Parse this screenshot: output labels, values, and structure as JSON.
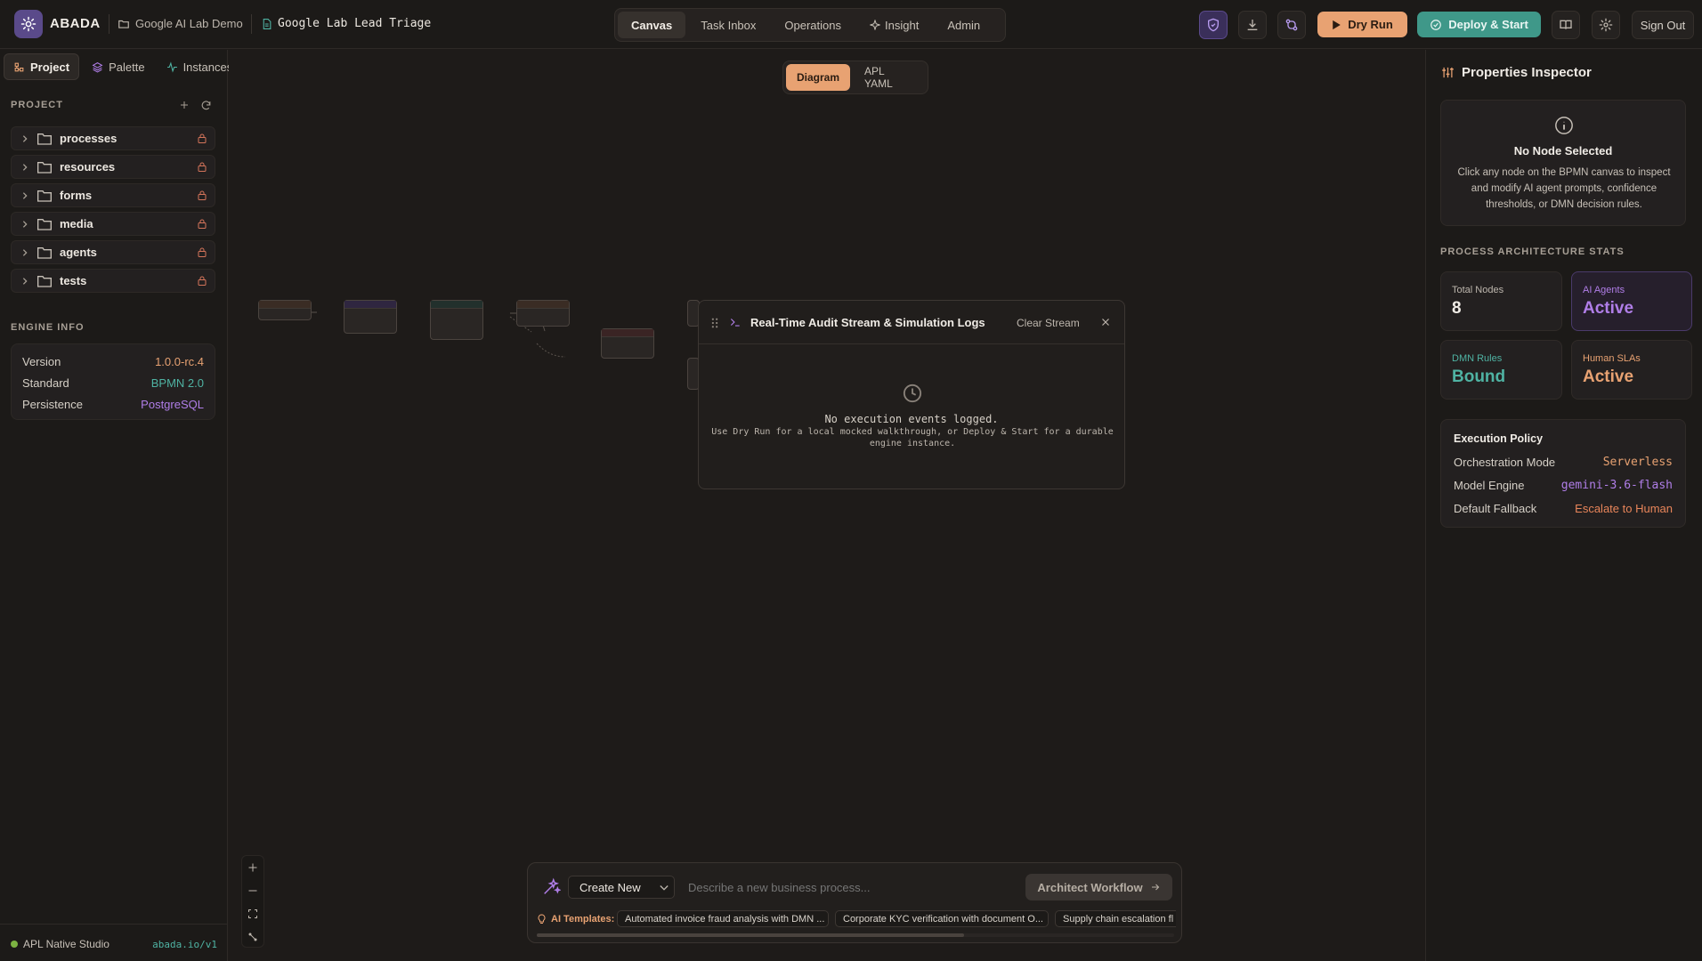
{
  "app": {
    "brand": "ABADA",
    "breadcrumbs": [
      "Google AI Lab Demo",
      "Google Lab Lead Triage"
    ]
  },
  "nav": {
    "tabs": [
      {
        "label": "Canvas",
        "active": true
      },
      {
        "label": "Task Inbox",
        "active": false
      },
      {
        "label": "Operations",
        "active": false
      },
      {
        "label": "Insight",
        "active": false,
        "icon": "sparkle-icon"
      },
      {
        "label": "Admin",
        "active": false
      }
    ]
  },
  "toolbar": {
    "dry_run_label": "Dry Run",
    "deploy_label": "Deploy & Start",
    "sign_out_label": "Sign Out",
    "icons": [
      "shield-icon",
      "download-icon",
      "git-compare-icon",
      "book-icon",
      "gear-icon"
    ]
  },
  "sidebar": {
    "tabs": [
      {
        "label": "Project",
        "active": true
      },
      {
        "label": "Palette",
        "active": false
      },
      {
        "label": "Instances",
        "active": false
      }
    ],
    "project_title": "PROJECT",
    "folders": [
      "processes",
      "resources",
      "forms",
      "media",
      "agents",
      "tests"
    ],
    "engine_title": "ENGINE INFO",
    "engine": [
      {
        "key": "Version",
        "value": "1.0.0-rc.4",
        "color": "#e8a272"
      },
      {
        "key": "Standard",
        "value": "BPMN 2.0",
        "color": "#4fb3a3"
      },
      {
        "key": "Persistence",
        "value": "PostgreSQL",
        "color": "#b07ee8"
      }
    ],
    "footer_label": "APL Native Studio",
    "footer_url": "abada.io/v1"
  },
  "canvas": {
    "view_tabs": [
      {
        "label": "Diagram",
        "active": true
      },
      {
        "label": "APL YAML",
        "active": false
      }
    ]
  },
  "log_panel": {
    "title": "Real-Time Audit Stream & Simulation Logs",
    "clear_label": "Clear Stream",
    "empty_title": "No execution events logged.",
    "empty_hint": "Use Dry Run for a local mocked walkthrough, or Deploy & Start for a durable engine instance."
  },
  "prompt": {
    "mode": "Create New",
    "placeholder": "Describe a new business process...",
    "action_label": "Architect Workflow",
    "templates_label": "AI Templates:",
    "templates": [
      "Automated invoice fraud analysis with DMN ...",
      "Corporate KYC verification with document O...",
      "Supply chain escalation fl"
    ]
  },
  "inspector": {
    "title": "Properties Inspector",
    "empty_title": "No Node Selected",
    "empty_text": "Click any node on the BPMN canvas to inspect and modify AI agent prompts, confidence thresholds, or DMN decision rules.",
    "stats_title": "PROCESS ARCHITECTURE STATS",
    "stats": [
      {
        "label": "Total Nodes",
        "value": "8",
        "color": "#f0ece6",
        "label_color": "#bdb6ad"
      },
      {
        "label": "AI Agents",
        "value": "Active",
        "color": "#b07ee8",
        "label_color": "#b07ee8"
      },
      {
        "label": "DMN Rules",
        "value": "Bound",
        "color": "#4fb3a3",
        "label_color": "#4fb3a3"
      },
      {
        "label": "Human SLAs",
        "value": "Active",
        "color": "#e8a272",
        "label_color": "#e8a272"
      }
    ],
    "policy_title": "Execution Policy",
    "policy": [
      {
        "key": "Orchestration Mode",
        "value": "Serverless",
        "color": "#e8a272"
      },
      {
        "key": "Model Engine",
        "value": "gemini-3.6-flash",
        "color": "#b07ee8"
      },
      {
        "key": "Default Fallback",
        "value": "Escalate to Human",
        "color": "#e8855a"
      }
    ]
  }
}
